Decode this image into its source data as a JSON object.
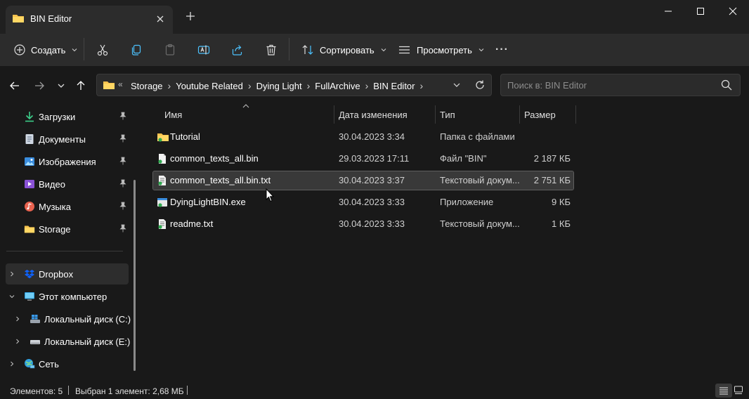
{
  "window": {
    "tab_title": "BIN Editor",
    "icons": [
      "folder-icon",
      "close-icon",
      "plus-icon",
      "minimize-icon",
      "maximize-icon",
      "close-window-icon"
    ]
  },
  "toolbar": {
    "create_label": "Создать",
    "sort_label": "Сортировать",
    "view_label": "Просмотреть",
    "more_label": "···"
  },
  "address": {
    "overflow": "«",
    "crumbs": [
      "Storage",
      "Youtube Related",
      "Dying Light",
      "FullArchive",
      "BIN Editor"
    ],
    "separator": "›"
  },
  "search": {
    "placeholder": "Поиск в: BIN Editor"
  },
  "sidebar": {
    "quick": [
      {
        "label": "Загрузки",
        "icon": "download-icon"
      },
      {
        "label": "Документы",
        "icon": "document-icon"
      },
      {
        "label": "Изображения",
        "icon": "pictures-icon"
      },
      {
        "label": "Видео",
        "icon": "video-icon"
      },
      {
        "label": "Музыка",
        "icon": "music-icon"
      },
      {
        "label": "Storage",
        "icon": "folder-icon"
      }
    ],
    "tree": [
      {
        "label": "Dropbox",
        "icon": "dropbox-icon"
      },
      {
        "label": "Этот компьютер",
        "icon": "computer-icon"
      },
      {
        "label": "Локальный диск (C:)",
        "icon": "windows-drive-icon"
      },
      {
        "label": "Локальный диск (E:)",
        "icon": "drive-icon"
      },
      {
        "label": "Сеть",
        "icon": "network-icon"
      }
    ]
  },
  "columns": {
    "name": "Имя",
    "date": "Дата изменения",
    "type": "Тип",
    "size": "Размер"
  },
  "files": [
    {
      "name": "Tutorial",
      "date": "30.04.2023 3:34",
      "type": "Папка с файлами",
      "size": "",
      "icon": "folder-icon"
    },
    {
      "name": "common_texts_all.bin",
      "date": "29.03.2023 17:11",
      "type": "Файл \"BIN\"",
      "size": "2 187 КБ",
      "icon": "file-icon"
    },
    {
      "name": "common_texts_all.bin.txt",
      "date": "30.04.2023 3:37",
      "type": "Текстовый докум...",
      "size": "2 751 КБ",
      "icon": "text-file-icon"
    },
    {
      "name": "DyingLightBIN.exe",
      "date": "30.04.2023 3:33",
      "type": "Приложение",
      "size": "9 КБ",
      "icon": "exe-icon"
    },
    {
      "name": "readme.txt",
      "date": "30.04.2023 3:33",
      "type": "Текстовый докум...",
      "size": "1 КБ",
      "icon": "text-file-icon"
    }
  ],
  "status": {
    "items_count": "Элементов: 5",
    "selected": "Выбран 1 элемент: 2,68 МБ"
  },
  "colors": {
    "accent": "#4cc2ff",
    "folder": "#f6c24e",
    "background": "#191919",
    "toolbar": "#2c2c2c"
  }
}
